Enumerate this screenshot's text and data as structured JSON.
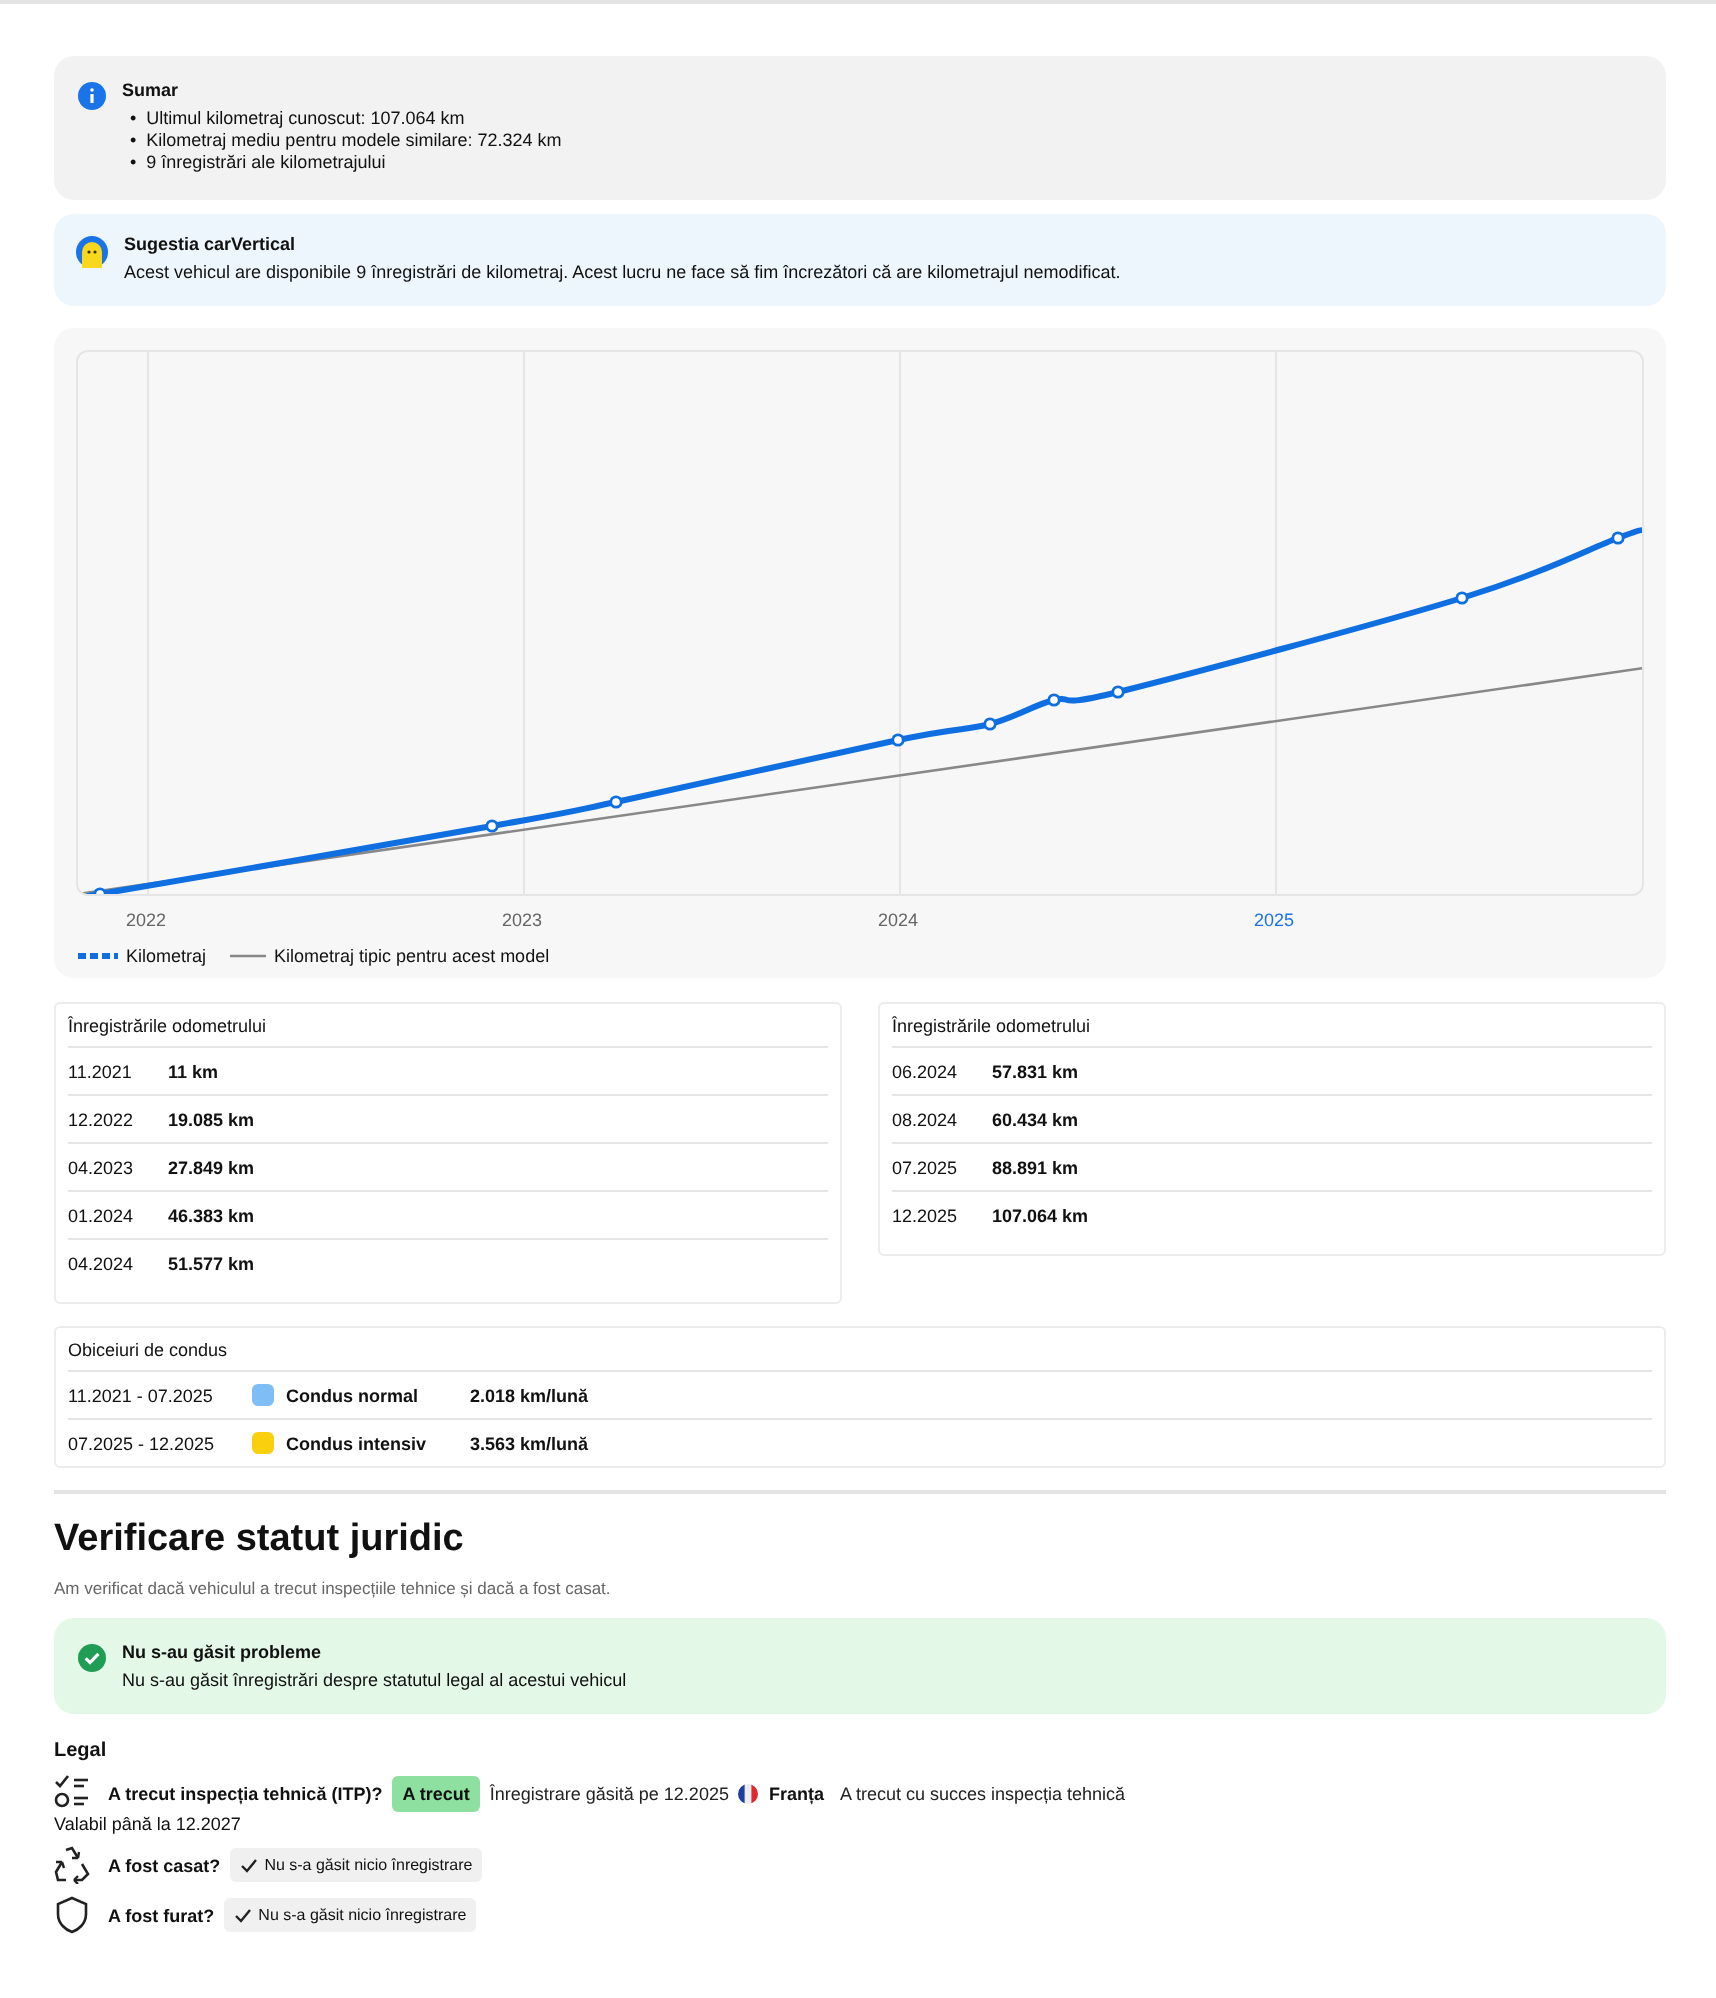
{
  "summary": {
    "title": "Sumar",
    "bullet": "•",
    "items": [
      "Ultimul kilometraj cunoscut: 107.064 km",
      "Kilometraj mediu pentru modele similare: 72.324 km",
      "9 înregistrări ale kilometrajului"
    ]
  },
  "suggestion": {
    "title": "Sugestia carVertical",
    "text": "Acest vehicul are disponibile 9 înregistrări de kilometraj. Acest lucru ne face să fim încrezători că are kilometrajul nemodificat."
  },
  "chart": {
    "x_labels": [
      {
        "label": "2022",
        "selected": false
      },
      {
        "label": "2023",
        "selected": false
      },
      {
        "label": "2024",
        "selected": false
      },
      {
        "label": "2025",
        "selected": true
      }
    ],
    "legend": [
      {
        "kind": "dotted",
        "label": "Kilometraj"
      },
      {
        "kind": "line",
        "label": "Kilometraj tipic pentru acest model"
      }
    ]
  },
  "odometer_tables": [
    {
      "title": "Înregistrările odometrului",
      "rows": [
        {
          "date": "11.2021",
          "km": "11 km"
        },
        {
          "date": "12.2022",
          "km": "19.085 km"
        },
        {
          "date": "04.2023",
          "km": "27.849 km"
        },
        {
          "date": "01.2024",
          "km": "46.383 km"
        },
        {
          "date": "04.2024",
          "km": "51.577 km"
        }
      ]
    },
    {
      "title": "Înregistrările odometrului",
      "rows": [
        {
          "date": "06.2024",
          "km": "57.831 km"
        },
        {
          "date": "08.2024",
          "km": "60.434 km"
        },
        {
          "date": "07.2025",
          "km": "88.891 km"
        },
        {
          "date": "12.2025",
          "km": "107.064 km"
        }
      ]
    }
  ],
  "driving_habits": {
    "title": "Obiceiuri de condus",
    "rows": [
      {
        "period": "11.2021 - 07.2025",
        "color": "#7fbdf6",
        "style": "Condus normal",
        "rate": "2.018 km/lună"
      },
      {
        "period": "07.2025 - 12.2025",
        "color": "#f9cf0e",
        "style": "Condus intensiv",
        "rate": "3.563 km/lună"
      }
    ]
  },
  "legal": {
    "title": "Verificare statut juridic",
    "subtitle": "Am verificat dacă vehiculul a trecut inspecțiile tehnice și dacă a fost casat.",
    "status": {
      "title": "Nu s-au găsit probleme",
      "text": "Nu s-au găsit înregistrări despre statutul legal al acestui vehicul"
    },
    "heading": "Legal",
    "checks": [
      {
        "kind": "inspection",
        "question": "A trecut inspecția tehnică (ITP)?",
        "badge": "A trecut",
        "passed": true,
        "found": "Înregistrare găsită pe 12.2025",
        "country": "Franța",
        "result": "A trecut cu succes inspecția tehnică",
        "valid": "Valabil până la 12.2027"
      },
      {
        "kind": "scrapped",
        "question": "A fost casat?",
        "badge": "Nu s-a găsit nicio înregistrare",
        "passed": false
      },
      {
        "kind": "stolen",
        "question": "A fost furat?",
        "badge": "Nu s-a găsit nicio înregistrare",
        "passed": false
      }
    ]
  }
}
